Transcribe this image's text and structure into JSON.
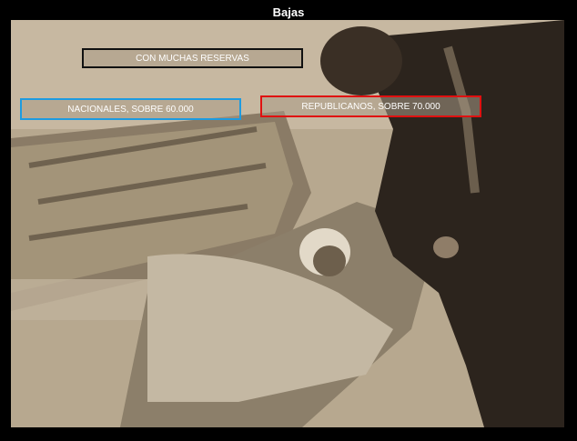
{
  "title": "Bajas",
  "labels": {
    "top": "CON MUCHAS RESERVAS",
    "nationals": "NACIONALES, SOBRE 60.000",
    "republicans": "REPUBLICANOS, SOBRE 70.000"
  },
  "colors": {
    "top_border": "#111111",
    "nationals_border": "#1d9be0",
    "republicans_border": "#e01010"
  }
}
